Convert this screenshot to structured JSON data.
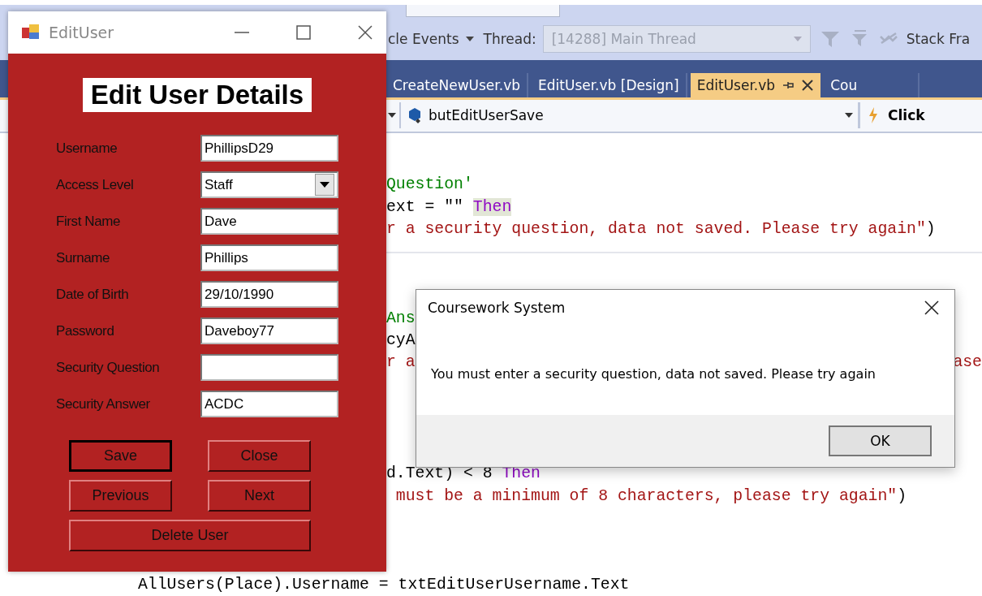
{
  "ide": {
    "toolbar": {
      "events_label": "cle Events",
      "thread_label": "Thread:",
      "thread_value": "[14288] Main Thread",
      "stack_label": "Stack Fra"
    },
    "tabs": [
      {
        "label": "CreateNewUser.vb",
        "selected": false
      },
      {
        "label": "EditUser.vb [Design]",
        "selected": false
      },
      {
        "label": "EditUser.vb",
        "selected": true
      },
      {
        "label": "Cou",
        "selected": false
      }
    ],
    "navigation": {
      "member": "butEditUserSave",
      "event": "Click"
    },
    "code_lines": [
      {
        "kind": "code",
        "covered": true,
        "segments": [
          {
            "text": "Question'",
            "kind": "comment"
          }
        ]
      },
      {
        "kind": "code",
        "covered": true,
        "segments": [
          {
            "text": "ext = \"\" ",
            "kind": "plain"
          },
          {
            "text": "Then",
            "kind": "keyword",
            "highlighted": true
          }
        ]
      },
      {
        "kind": "code",
        "covered": true,
        "segments": [
          {
            "text": "r a security question, data not saved. Please try again\"",
            "kind": "string"
          },
          {
            "text": ")",
            "kind": "plain"
          }
        ]
      },
      {
        "kind": "separator"
      },
      {
        "kind": "blank"
      },
      {
        "kind": "blank"
      },
      {
        "kind": "code",
        "covered": true,
        "segments": [
          {
            "text": "Ans",
            "kind": "comment"
          }
        ]
      },
      {
        "kind": "code",
        "covered": true,
        "segments": [
          {
            "text": "cyA",
            "kind": "plain"
          }
        ]
      },
      {
        "kind": "code",
        "covered": true,
        "segments": [
          {
            "text": "r a",
            "kind": "string"
          }
        ],
        "right_segments": [
          {
            "text": "ase",
            "kind": "string"
          }
        ]
      },
      {
        "kind": "blank"
      },
      {
        "kind": "blank"
      },
      {
        "kind": "blank"
      },
      {
        "kind": "blank"
      },
      {
        "kind": "code",
        "covered": true,
        "segments": [
          {
            "text": "d.Text) < 8 ",
            "kind": "plain"
          },
          {
            "text": "Then",
            "kind": "keyword"
          }
        ]
      },
      {
        "kind": "code",
        "covered": true,
        "segments": [
          {
            "text": " must be a minimum of 8 characters, please try again\"",
            "kind": "string"
          },
          {
            "text": ")",
            "kind": "plain"
          }
        ]
      },
      {
        "kind": "blank"
      },
      {
        "kind": "blank"
      },
      {
        "kind": "blank"
      },
      {
        "kind": "code",
        "segments": [
          {
            "text": "AllUsers(Place).Username = txtEditUserUsername.Text",
            "kind": "plain"
          }
        ]
      }
    ]
  },
  "edit_user_window": {
    "title": "EditUser",
    "heading": "Edit User Details",
    "fields": [
      {
        "label": "Username",
        "value": "PhillipsD29",
        "kind": "text"
      },
      {
        "label": "Access Level",
        "value": "Staff",
        "kind": "combo"
      },
      {
        "label": "First Name",
        "value": "Dave",
        "kind": "text"
      },
      {
        "label": "Surname",
        "value": "Phillips",
        "kind": "text"
      },
      {
        "label": "Date of Birth",
        "value": "29/10/1990",
        "kind": "text"
      },
      {
        "label": "Password",
        "value": "Daveboy77",
        "kind": "text"
      },
      {
        "label": "Security Question",
        "kind": "text"
      },
      {
        "label": "Security Answer",
        "value": "ACDC",
        "kind": "text"
      }
    ],
    "buttons": [
      {
        "label": "Save",
        "default": true
      },
      {
        "label": "Close",
        "default": false
      },
      {
        "label": "Previous",
        "default": false
      },
      {
        "label": "Next",
        "default": false
      },
      {
        "label": "Delete User",
        "default": false
      }
    ]
  },
  "message_box": {
    "title": "Coursework System",
    "message": "You must enter a security question, data not saved. Please try again",
    "button": "OK"
  }
}
